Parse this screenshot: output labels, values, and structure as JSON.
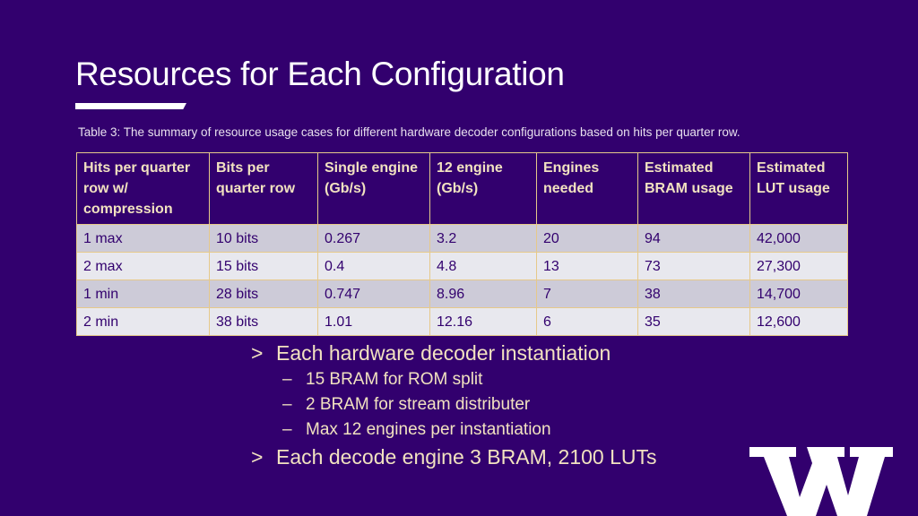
{
  "slide": {
    "title": "Resources for Each Configuration",
    "caption": "Table 3: The summary of resource usage cases for different hardware decoder configurations based on hits per quarter row."
  },
  "table": {
    "headers": [
      "Hits per quarter row w/ compression",
      "Bits per quarter row",
      "Single engine (Gb/s)",
      "12 engine (Gb/s)",
      "Engines needed",
      "Estimated BRAM usage",
      "Estimated LUT usage"
    ],
    "rows": [
      [
        "1 max",
        "10 bits",
        "0.267",
        "3.2",
        "20",
        "94",
        "42,000"
      ],
      [
        "2 max",
        "15 bits",
        "0.4",
        "4.8",
        "13",
        "73",
        "27,300"
      ],
      [
        "1 min",
        "28 bits",
        "0.747",
        "8.96",
        "7",
        "38",
        "14,700"
      ],
      [
        "2 min",
        "38 bits",
        "1.01",
        "12.16",
        "6",
        "35",
        "12,600"
      ]
    ]
  },
  "bullets": [
    {
      "level": 1,
      "marker": ">",
      "text": "Each hardware decoder instantiation"
    },
    {
      "level": 2,
      "marker": "–",
      "text": "15 BRAM for ROM split"
    },
    {
      "level": 2,
      "marker": "–",
      "text": "2 BRAM for stream distributer"
    },
    {
      "level": 2,
      "marker": "–",
      "text": "Max 12 engines per instantiation"
    },
    {
      "level": 1,
      "marker": ">",
      "text": "Each decode engine 3 BRAM, 2100 LUTs"
    }
  ],
  "logo": {
    "icon": "uw-w-logo-icon"
  },
  "colors": {
    "background": "#32006e",
    "accent_gold": "#f2e2c0",
    "row_dark": "#cdcbd8",
    "row_light": "#e8e8ee"
  }
}
